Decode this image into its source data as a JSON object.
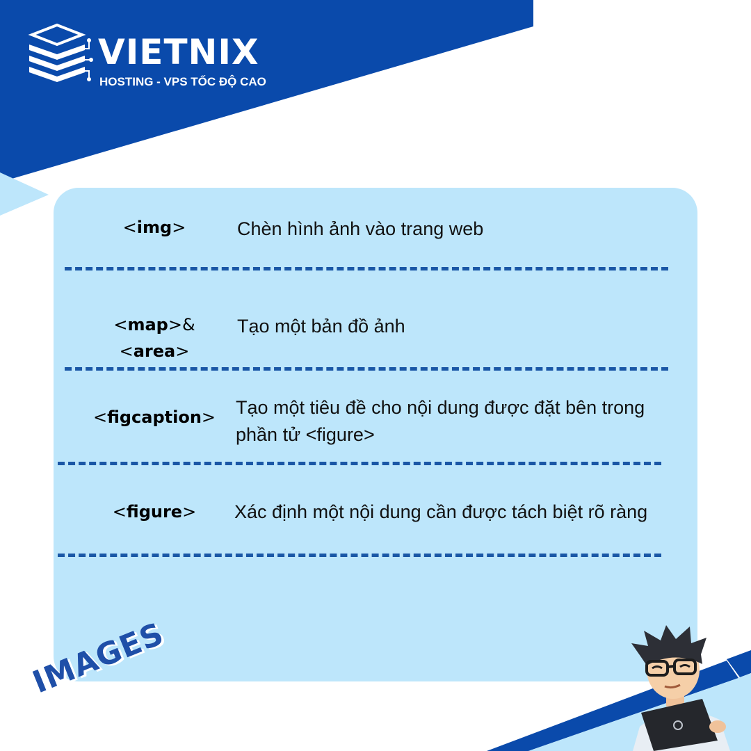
{
  "brand": {
    "name": "VIETNIX",
    "tagline": "HOSTING - VPS TỐC ĐỘ CAO"
  },
  "rows": [
    {
      "tag_open": "<",
      "tag_name": "img",
      "tag_close": ">",
      "tag_name2": "",
      "tag_close2": "",
      "description": "Chèn hình ảnh vào trang web"
    },
    {
      "tag_open": "<",
      "tag_name": "map",
      "tag_close": ">&",
      "tag_open2": "<",
      "tag_name2": "area",
      "tag_close2": ">",
      "description": "Tạo một bản đồ ảnh"
    },
    {
      "tag_open": "<",
      "tag_name": "figcaption",
      "tag_close": ">",
      "description_line1": "Tạo một tiêu đề cho nội dung được đặt bên trong",
      "description_line2": "phần tử <figure>"
    },
    {
      "tag_open": "<",
      "tag_name": "figure",
      "tag_close": ">",
      "description": "Xác định một nội dung cần được tách biệt rõ ràng"
    }
  ],
  "footer_label": "IMAGES",
  "colors": {
    "primary_blue": "#0047ab",
    "light_blue": "#bde6fb",
    "dash_blue": "#1a57a6"
  }
}
